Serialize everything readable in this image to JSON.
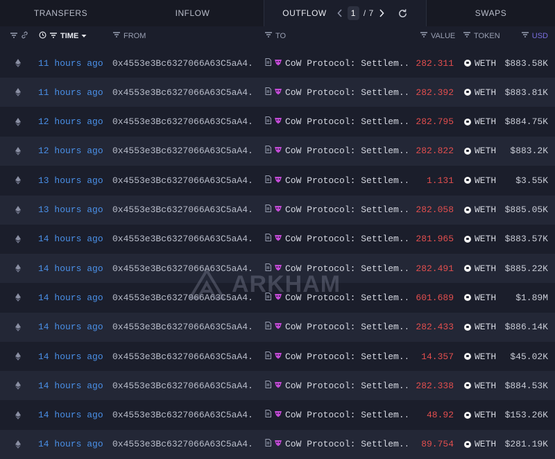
{
  "tabs": {
    "transfers": "TRANSFERS",
    "inflow": "INFLOW",
    "outflow": "OUTFLOW",
    "swaps": "SWAPS",
    "page_current": "1",
    "page_sep": "/ 7"
  },
  "columns": {
    "time": "TIME",
    "from": "FROM",
    "to": "TO",
    "value": "VALUE",
    "token": "TOKEN",
    "usd": "USD"
  },
  "colors": {
    "time_link": "#4a90e8",
    "value_out": "#e24e4e",
    "cow_icon": "#c54bd8"
  },
  "watermark": "ARKHAM",
  "rows": [
    {
      "time": "11 hours ago",
      "from": "0x4553e3Bc6327066A63C5aA4...",
      "to": "CoW Protocol: Settlem...",
      "value": "282.311",
      "token": "WETH",
      "usd": "$883.58K"
    },
    {
      "time": "11 hours ago",
      "from": "0x4553e3Bc6327066A63C5aA4...",
      "to": "CoW Protocol: Settlem...",
      "value": "282.392",
      "token": "WETH",
      "usd": "$883.81K"
    },
    {
      "time": "12 hours ago",
      "from": "0x4553e3Bc6327066A63C5aA4...",
      "to": "CoW Protocol: Settlem...",
      "value": "282.795",
      "token": "WETH",
      "usd": "$884.75K"
    },
    {
      "time": "12 hours ago",
      "from": "0x4553e3Bc6327066A63C5aA4...",
      "to": "CoW Protocol: Settlem...",
      "value": "282.822",
      "token": "WETH",
      "usd": "$883.2K"
    },
    {
      "time": "13 hours ago",
      "from": "0x4553e3Bc6327066A63C5aA4...",
      "to": "CoW Protocol: Settlem...",
      "value": "1.131",
      "token": "WETH",
      "usd": "$3.55K"
    },
    {
      "time": "13 hours ago",
      "from": "0x4553e3Bc6327066A63C5aA4...",
      "to": "CoW Protocol: Settlem...",
      "value": "282.058",
      "token": "WETH",
      "usd": "$885.05K"
    },
    {
      "time": "14 hours ago",
      "from": "0x4553e3Bc6327066A63C5aA4...",
      "to": "CoW Protocol: Settlem...",
      "value": "281.965",
      "token": "WETH",
      "usd": "$883.57K"
    },
    {
      "time": "14 hours ago",
      "from": "0x4553e3Bc6327066A63C5aA4...",
      "to": "CoW Protocol: Settlem...",
      "value": "282.491",
      "token": "WETH",
      "usd": "$885.22K"
    },
    {
      "time": "14 hours ago",
      "from": "0x4553e3Bc6327066A63C5aA4...",
      "to": "CoW Protocol: Settlem...",
      "value": "601.689",
      "token": "WETH",
      "usd": "$1.89M"
    },
    {
      "time": "14 hours ago",
      "from": "0x4553e3Bc6327066A63C5aA4...",
      "to": "CoW Protocol: Settlem...",
      "value": "282.433",
      "token": "WETH",
      "usd": "$886.14K"
    },
    {
      "time": "14 hours ago",
      "from": "0x4553e3Bc6327066A63C5aA4...",
      "to": "CoW Protocol: Settlem...",
      "value": "14.357",
      "token": "WETH",
      "usd": "$45.02K"
    },
    {
      "time": "14 hours ago",
      "from": "0x4553e3Bc6327066A63C5aA4...",
      "to": "CoW Protocol: Settlem...",
      "value": "282.338",
      "token": "WETH",
      "usd": "$884.53K"
    },
    {
      "time": "14 hours ago",
      "from": "0x4553e3Bc6327066A63C5aA4...",
      "to": "CoW Protocol: Settlem...",
      "value": "48.92",
      "token": "WETH",
      "usd": "$153.26K"
    },
    {
      "time": "14 hours ago",
      "from": "0x4553e3Bc6327066A63C5aA4...",
      "to": "CoW Protocol: Settlem...",
      "value": "89.754",
      "token": "WETH",
      "usd": "$281.19K"
    }
  ]
}
